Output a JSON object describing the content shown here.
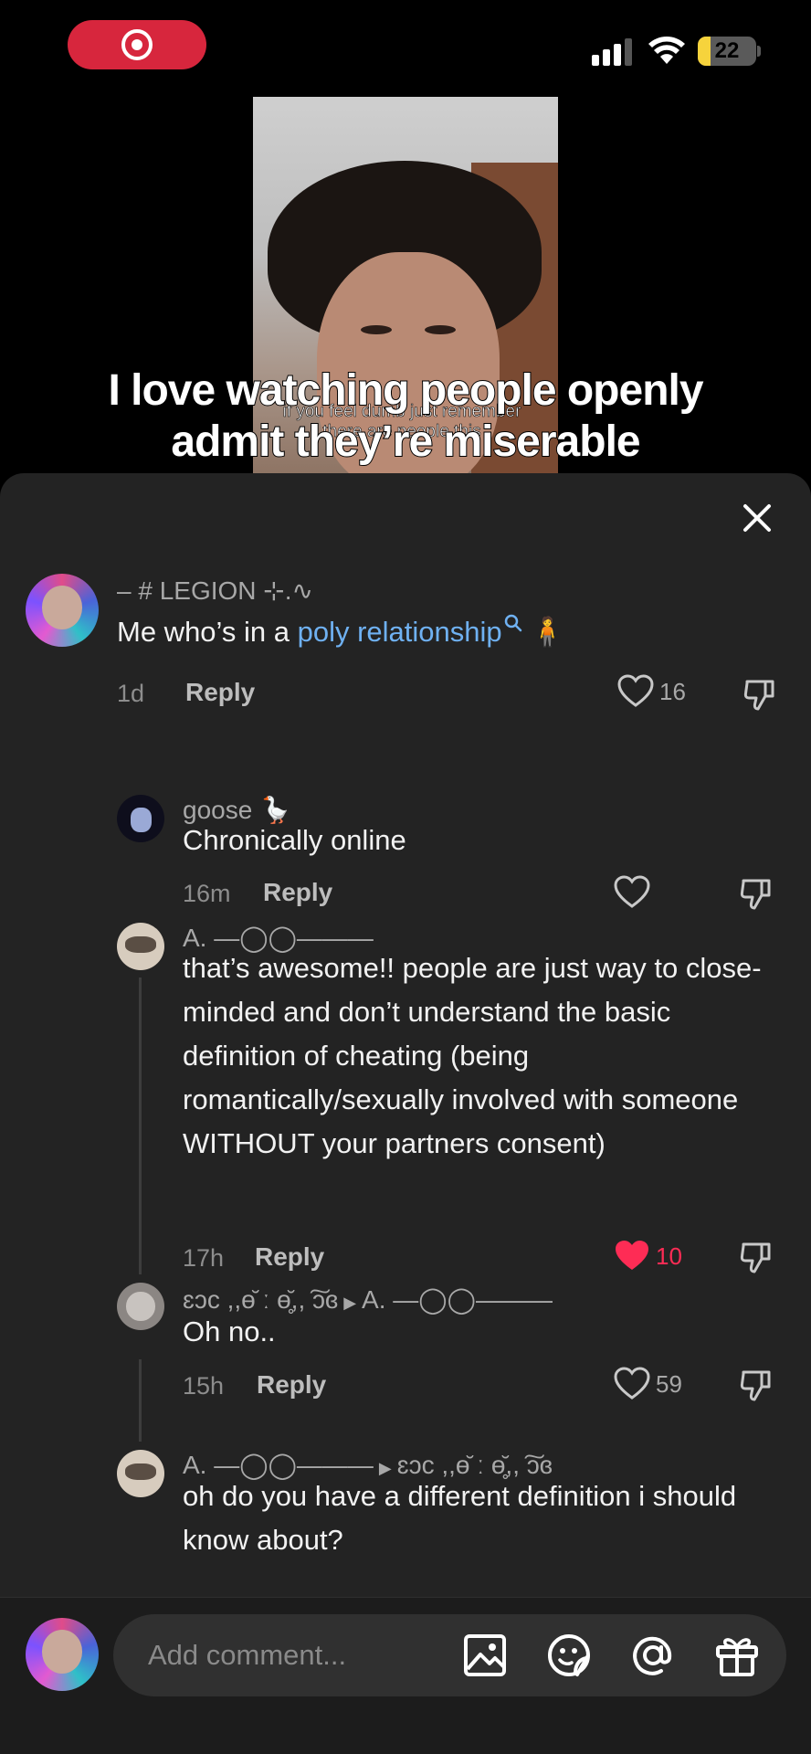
{
  "status_bar": {
    "battery": "22",
    "battery_level": 0.22
  },
  "video": {
    "small_caption": "if you feel dumb just remember there are people this",
    "overlay_caption": "I love watching people openly admit they’re miserable"
  },
  "comments": [
    {
      "username": "– # LEGION ⊹.∿",
      "text_before": "Me who’s in a ",
      "link": "poly relationship",
      "text_after": " 🧍",
      "time": "1d",
      "reply_label": "Reply",
      "likes": "16",
      "liked": false
    },
    {
      "username": "goose 🪿",
      "text": "Chronically online",
      "time": "16m",
      "reply_label": "Reply",
      "likes": "",
      "liked": false
    },
    {
      "username": "A. —◯◯———",
      "text": "that’s awesome!! people are just way to close-minded and don’t understand the basic definition of cheating (being romantically/sexually involved with someone WITHOUT your partners consent)",
      "time": "17h",
      "reply_label": "Reply",
      "likes": "10",
      "liked": true
    },
    {
      "username": "ɛɔc ,,ө̆ ː ө̥̆,, ͠ɔɞ",
      "reply_to": "A. —◯◯———",
      "text": "Oh no..",
      "time": "15h",
      "reply_label": "Reply",
      "likes": "59",
      "liked": false
    },
    {
      "username": "A. —◯◯———",
      "reply_to": "ɛɔc ,,ө̆ ː ө̥̆,, ͠ɔɞ",
      "text": "oh do you have a different definition i should know about?"
    }
  ],
  "input": {
    "placeholder": "Add comment..."
  },
  "icons": [
    "close-icon",
    "heart-icon",
    "dislike-icon",
    "image-icon",
    "sticker-icon",
    "mention-icon",
    "gift-icon"
  ],
  "colors": {
    "accent_like": "#fe2c55",
    "link": "#6fb1f2",
    "record": "#d7263d",
    "battery": "#f6d33c"
  }
}
